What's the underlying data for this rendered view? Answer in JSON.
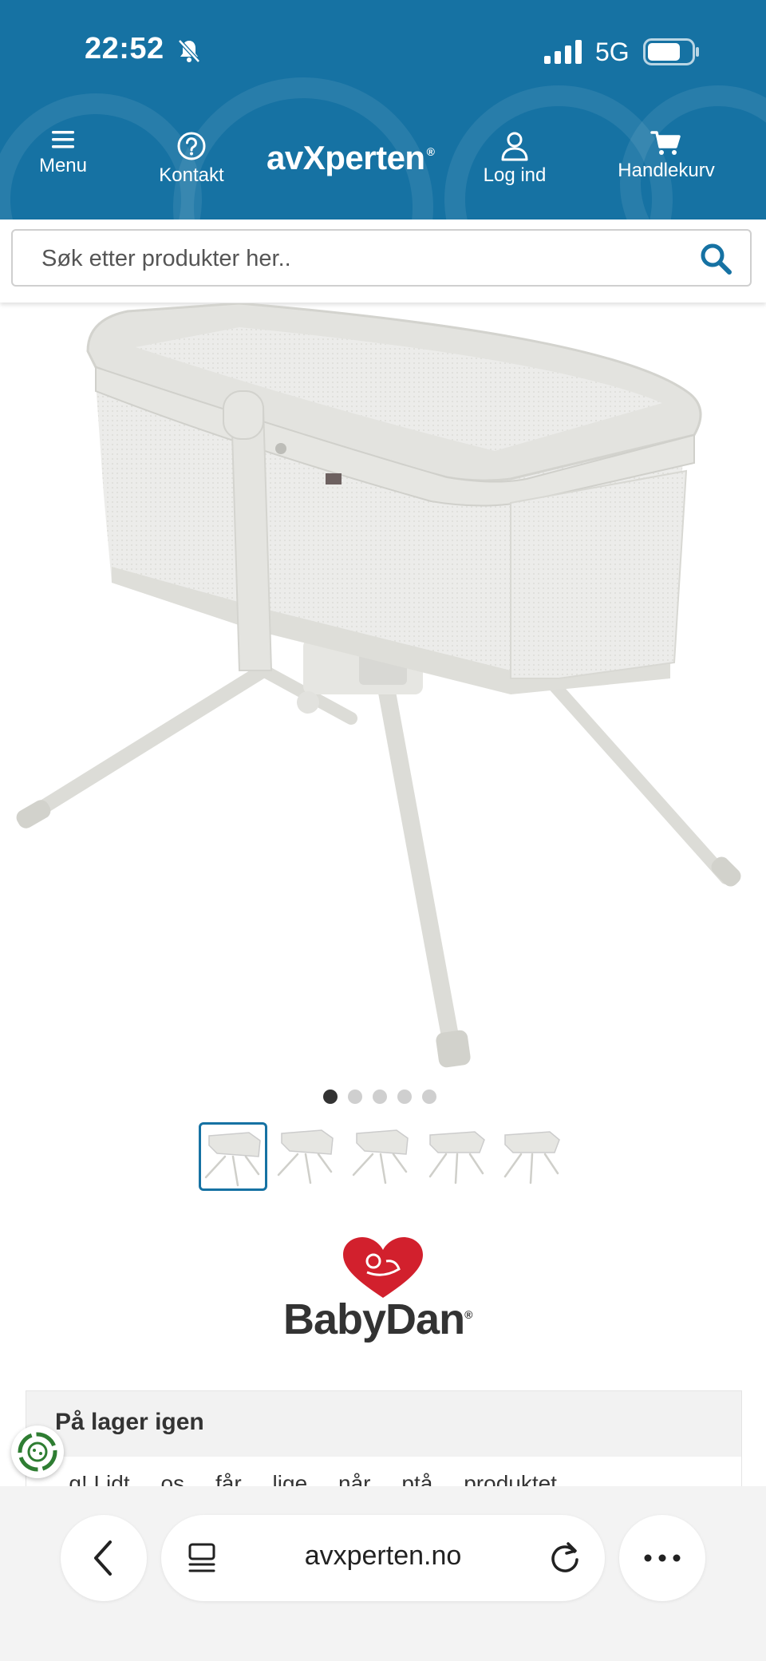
{
  "status_bar": {
    "time": "22:52",
    "network": "5G",
    "icons": [
      "bell-off-icon",
      "signal-icon",
      "battery-icon"
    ]
  },
  "header": {
    "background": "#1672a3",
    "logo_text": "avXperten",
    "logo_mark": "®",
    "nav": [
      {
        "label": "Menu",
        "icon": "menu-icon"
      },
      {
        "label": "Kontakt",
        "icon": "help-circle-icon"
      },
      {
        "label": "Log ind",
        "icon": "user-icon"
      },
      {
        "label": "Handlekurv",
        "icon": "cart-icon"
      }
    ]
  },
  "search": {
    "placeholder": "Søk etter produkter her..",
    "icon": "search-icon"
  },
  "gallery": {
    "current_slide": 1,
    "total_slides": 5,
    "thumbnails": 5,
    "active_thumbnail": 1
  },
  "brand": {
    "name": "BabyDan",
    "mark": "®"
  },
  "stock": {
    "title": "På lager igen",
    "text": "...g! Lidt ... os ... får ... lige ... når ... ptå ... produktet"
  },
  "browser": {
    "url": "avxperten.no",
    "icons": [
      "back-icon",
      "tabs-icon",
      "reload-icon",
      "more-icon"
    ]
  }
}
